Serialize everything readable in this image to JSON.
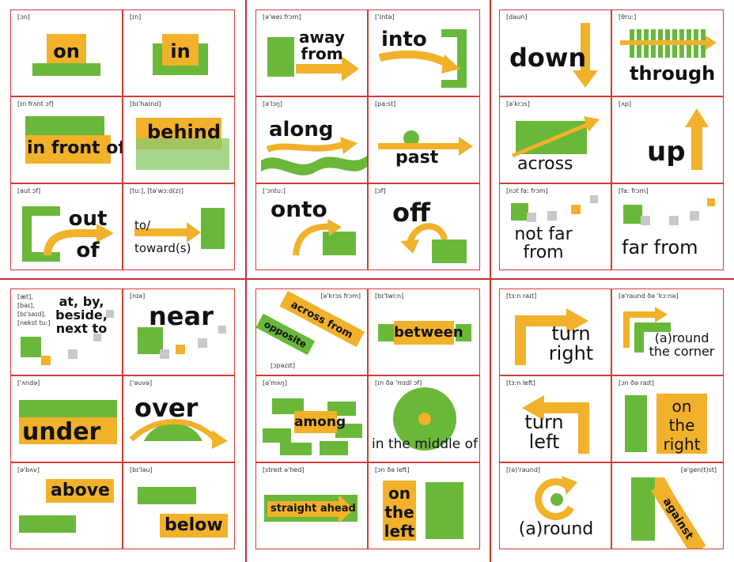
{
  "colors": {
    "green": "#6ab83a",
    "yellow": "#f2b12a",
    "red_line": "#c9302c",
    "grey": "#c8c8c8"
  },
  "cells": {
    "on": {
      "phon": "[ɔn]",
      "word": "on"
    },
    "in": {
      "phon": "[ɪn]",
      "word": "in"
    },
    "away": {
      "phon": "[ə'weɪ frɔm]",
      "word": "away from"
    },
    "into": {
      "phon": "['ɪntə]",
      "word": "into"
    },
    "down": {
      "phon": "[daun]",
      "word": "down"
    },
    "through": {
      "phon": "[θru:]",
      "word": "through"
    },
    "front": {
      "phon": "[ɪn frʌnt ɔf]",
      "word": "in front of"
    },
    "behind": {
      "phon": "[bɪ'haɪnd]",
      "word": "behind"
    },
    "along": {
      "phon": "[ə'lɔŋ]",
      "word": "along"
    },
    "past": {
      "phon": "[pa:st]",
      "word": "past"
    },
    "across": {
      "phon": "[ə'krɔs]",
      "word": "across"
    },
    "up": {
      "phon": "[ʌp]",
      "word": "up"
    },
    "outof": {
      "phon": "[aut ɔf]",
      "word": "out of"
    },
    "toward": {
      "phon": "[tu:], [tə'wɔ:d(z)]",
      "word": "to/ toward(s)"
    },
    "onto": {
      "phon": "['ɔntu:]",
      "word": "onto"
    },
    "off": {
      "phon": "[ɔf]",
      "word": "off"
    },
    "notfar": {
      "phon": "[nɔt fa: frɔm]",
      "word": "not far from"
    },
    "farfrom": {
      "phon": "[fa: frɔm]",
      "word": "far from"
    },
    "at": {
      "phon": "[æt], [baɪ], [bɪ'saɪd], [nekst tu:]",
      "word": "at, by, beside, next to"
    },
    "near": {
      "phon": "[nɪə]",
      "word": "near"
    },
    "acrossfrom": {
      "phon": "[ə'krɔs frɔm]",
      "phon2": "[ɔpəzɪt]",
      "word": "across from",
      "word2": "opposite"
    },
    "between": {
      "phon": "[bɪ'twi:n]",
      "word": "between"
    },
    "right": {
      "phon": "[tɜ:n raɪt]",
      "word": "turn right"
    },
    "corner": {
      "phon": "[ə'raund ðə 'kɔ:nə]",
      "word": "(a)round the corner"
    },
    "under": {
      "phon": "['ʌndə]",
      "word": "under"
    },
    "over": {
      "phon": "['əuvə]",
      "word": "over"
    },
    "among": {
      "phon": "[ə'mʌŋ]",
      "word": "among"
    },
    "middle": {
      "phon": "[ɪn ðə 'mɪdl ɔf]",
      "word": "in the middle of"
    },
    "left": {
      "phon": "[tɜ:n left]",
      "word": "turn left"
    },
    "ontheright": {
      "phon": "[ɔn ðə raɪt]",
      "word": "on the right"
    },
    "above": {
      "phon": "[ə'bʌv]",
      "word": "above"
    },
    "below": {
      "phon": "[bɪ'ləu]",
      "word": "below"
    },
    "straight": {
      "phon": "[streɪt ə'hed]",
      "word": "straight ahead"
    },
    "ontheleft": {
      "phon": "[ɔn ðə left]",
      "word": "on the left"
    },
    "around": {
      "phon": "[(ə)'raund]",
      "word": "(a)round"
    },
    "against": {
      "phon": "[ə'gen(t)st]",
      "word": "against"
    }
  }
}
